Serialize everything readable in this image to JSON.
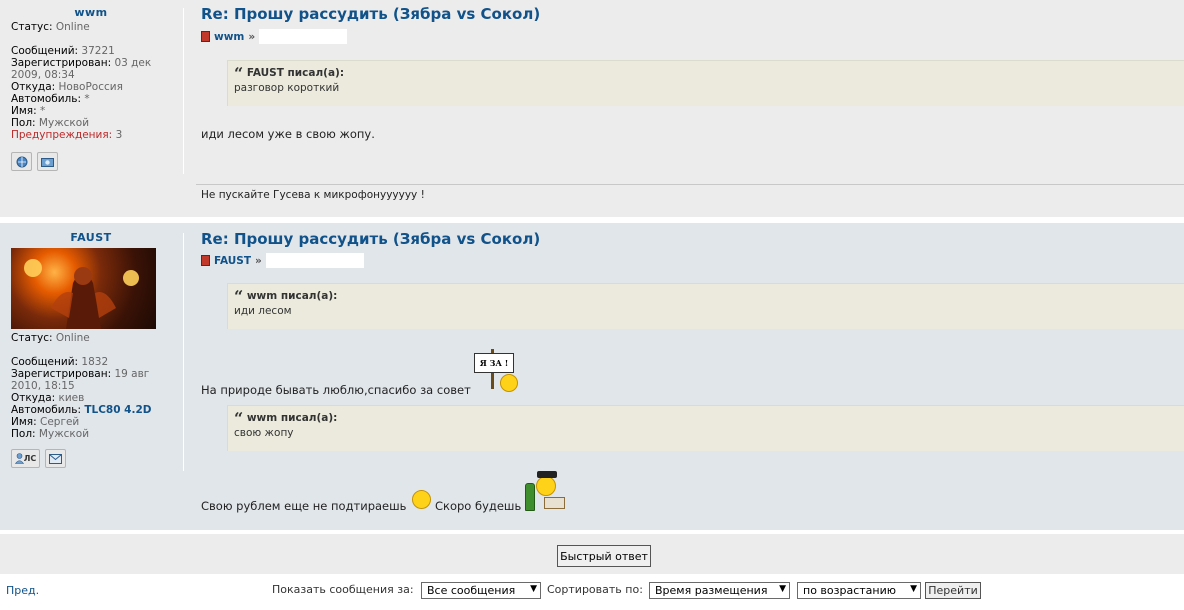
{
  "post1": {
    "username": "wwm",
    "status_label": "Статус:",
    "status_value": "Online",
    "posts_label": "Сообщений:",
    "posts_value": "37221",
    "reg_label": "Зарегистрирован:",
    "reg_value": "03 дек 2009, 08:34",
    "from_label": "Откуда:",
    "from_value": "НовоРоссия",
    "car_label": "Автомобиль:",
    "car_value": "*",
    "name_label": "Имя:",
    "name_value": "*",
    "sex_label": "Пол:",
    "sex_value": "Мужской",
    "warn_label": "Предупреждения:",
    "warn_value": "3",
    "title": "Re: Прошу рассудить (Зябра vs Сокол)",
    "author": "wwm",
    "author_sep": "»",
    "quote_author": "FAUST писал(а):",
    "quote_text": "разговор короткий",
    "text": "иди лесом уже в свою жопу.",
    "signature": "Не пускайте Гусева к микрофонуууууу !"
  },
  "post2": {
    "username": "FAUST",
    "status_label": "Статус:",
    "status_value": "Online",
    "posts_label": "Сообщений:",
    "posts_value": "1832",
    "reg_label": "Зарегистрирован:",
    "reg_value": "19 авг 2010, 18:15",
    "from_label": "Откуда:",
    "from_value": "киев",
    "car_label": "Автомобиль:",
    "car_value": "TLC80 4.2D",
    "name_label": "Имя:",
    "name_value": "Сергей",
    "sex_label": "Пол:",
    "sex_value": "Мужской",
    "title": "Re: Прошу рассудить (Зябра vs Сокол)",
    "author": "FAUST",
    "author_sep": "»",
    "quote1_author": "wwm писал(а):",
    "quote1_text": "иди лесом",
    "text1": "На природе бывать люблю,спасибо за совет",
    "sign_text": "Я ЗА !",
    "quote2_author": "wwm писал(а):",
    "quote2_text": "свою жопу",
    "text2a": "Свою рублем еще не подтираешь",
    "text2b": "Скоро будешь",
    "pm_label": "ЛС"
  },
  "quote_mark": "“",
  "quick_reply": "Быстрый ответ",
  "prev_link": "Пред.",
  "show_label": "Показать сообщения за:",
  "show_value": "Все сообщения",
  "sort_label": "Сортировать по:",
  "sort_value": "Время размещения",
  "order_value": "по возрастанию",
  "go_button": "Перейти",
  "select_arrow": "▼"
}
